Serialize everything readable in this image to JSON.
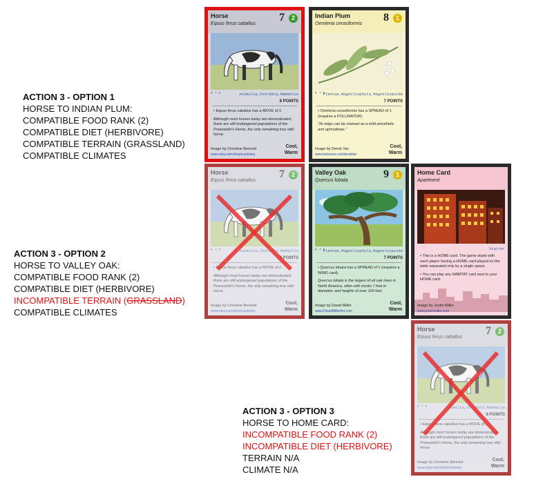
{
  "cards": {
    "horse": {
      "name": "Horse",
      "sci": "Equus ferus caballus",
      "number": "7",
      "badge": "2",
      "taxonomy": "Animalia,Chordata,Mammalia",
      "points": "8 POINTS",
      "line1": "• Equus ferus caballus has a MOVE of 2.",
      "line2": "Although most horses today are domesticated, there are still endangered populations of the Przewalski's Horse, the only remaining true wild horse.",
      "credit": "Image by Christine Bennett",
      "url": "www.etsy.com/shop/cactiviny",
      "climate": "Cool,\nWarm"
    },
    "plum": {
      "name": "Indian Plum",
      "sci": "Oemleria cerasiformis",
      "number": "8",
      "badge": "1",
      "taxonomy": "Plantae,Magnoliophyta,Magnoliopsida",
      "points": "7 POINTS",
      "line1": "• Oemleria cerasiformis has a SPREAD of 1 (requires a POLLINATOR).",
      "line2": "\"Its twigs can be chewed as a mild anesthetic and aphrodisiac.\"",
      "credit": "Image by Derek Tan",
      "url": "www.behance.net/derektan",
      "climate": "Cool,\nWarm"
    },
    "oak": {
      "name": "Valley Oak",
      "sci": "Quercus lobata",
      "number": "9",
      "badge": "1",
      "taxonomy": "Plantae,Magnoliophyta,Magnoliopsida",
      "points": "7 POINTS",
      "line1": "• Quercus lobata has a SPREAD of 1 (requires a WIND card).",
      "line2": "Quercus lobata is the largest of all oak trees in North America, often with trunks 7 feet in diameter, and heights of over 100 feet.",
      "credit": "Image by David Miller",
      "url": "www.DavidMillerArt.com",
      "climate": "Cool,\nWarm"
    },
    "home": {
      "name": "Home Card",
      "sci": "Apartment",
      "taxonomy": "Starter",
      "line1": "• This is a HOME card. The game starts with each player having a HOME card played on the table separated only by a single space.",
      "line2": "• You can play any HABITAT card next to your HOME card.",
      "credit": "Image by Justin Miller",
      "url": "www.justinmiller.com"
    }
  },
  "options": {
    "o1": {
      "title": "ACTION 3 - OPTION 1",
      "lines": [
        "HORSE TO INDIAN PLUM:",
        "COMPATIBLE FOOD RANK (2)",
        "COMPATIBLE DIET (HERBIVORE)",
        "COMPATIBLE TERRAIN (GRASSLAND)",
        "COMPATIBLE CLIMATES"
      ]
    },
    "o2": {
      "title": "ACTION 3 - OPTION 2",
      "lines": [
        "HORSE TO VALLEY OAK:",
        "COMPATIBLE FOOD RANK (2)",
        "COMPATIBLE DIET (HERBIVORE)"
      ],
      "bad_prefix": "INCOMPATIBLE TERRAIN (",
      "bad_strike": "GRASSLAND",
      "bad_suffix": ")",
      "last": "COMPATIBLE CLIMATES"
    },
    "o3": {
      "title": "ACTION 3 - OPTION 3",
      "line1": "HORSE TO HOME CARD:",
      "bad1": "INCOMPATIBLE FOOD RANK (2)",
      "bad2": "INCOMPATIBLE DIET (HERBIVORE)",
      "line4": "TERRAIN N/A",
      "line5": "CLIMATE N/A"
    }
  },
  "colors": {
    "horse_header": "#c9c9d4",
    "plum_header": "#f4efb8",
    "oak_header": "#bfdcc6",
    "home_header": "#f4c6d2",
    "badge_green": "#3a9a2a",
    "badge_yellow": "#e0b400",
    "incompatible": "#e01010"
  },
  "icons": [
    "horse-illustration",
    "plum-branch-illustration",
    "oak-tree-illustration",
    "city-skyline-illustration",
    "red-x-mark",
    "leaf-silhouette"
  ]
}
